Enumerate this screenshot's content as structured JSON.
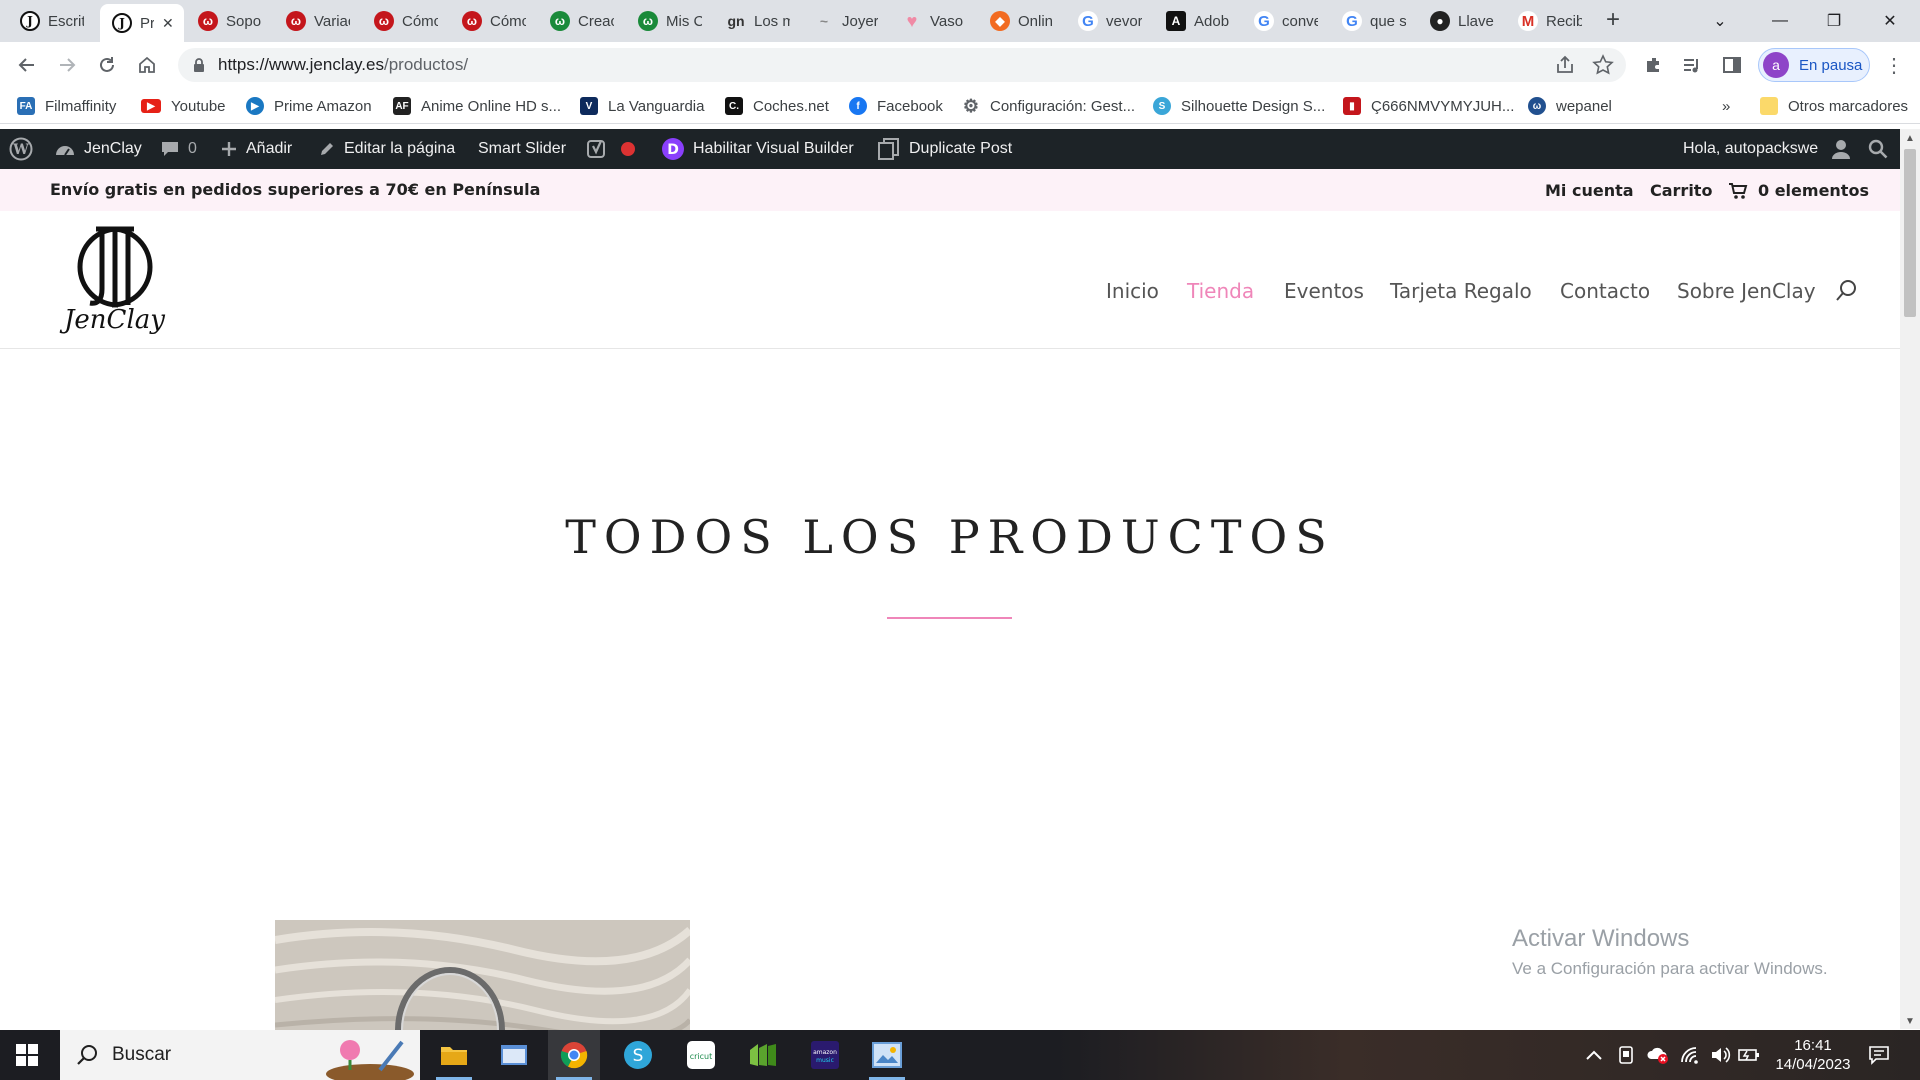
{
  "browser": {
    "tabs": [
      {
        "title": "Escrit",
        "icon": "jenclay-favicon"
      },
      {
        "title": "Pr",
        "icon": "jenclay-favicon",
        "active": true
      },
      {
        "title": "Sopo",
        "icon": "wpml-favicon"
      },
      {
        "title": "Variac",
        "icon": "wpml-favicon"
      },
      {
        "title": "Cómc",
        "icon": "wpml-favicon"
      },
      {
        "title": "Cómc",
        "icon": "wpml-favicon"
      },
      {
        "title": "Creac",
        "icon": "wp-green-favicon"
      },
      {
        "title": "Mis C",
        "icon": "wp-green-favicon"
      },
      {
        "title": "Los m",
        "icon": "gn-favicon"
      },
      {
        "title": "Joyer",
        "icon": "jewelry-favicon"
      },
      {
        "title": "Vaso",
        "icon": "heart-favicon"
      },
      {
        "title": "Onlin",
        "icon": "orange-favicon"
      },
      {
        "title": "vevor",
        "icon": "google-favicon"
      },
      {
        "title": "Adob",
        "icon": "adobe-favicon"
      },
      {
        "title": "conve",
        "icon": "google-favicon"
      },
      {
        "title": "que s",
        "icon": "google-favicon"
      },
      {
        "title": "Llave",
        "icon": "dark-favicon"
      },
      {
        "title": "Recib",
        "icon": "gmail-favicon"
      }
    ],
    "url_host": "https://www.jenclay.es",
    "url_path": "/productos/",
    "profile_initial": "a",
    "profile_label": "En pausa",
    "bookmarks": [
      {
        "label": "Filmaffinity",
        "color": "#2a6fb5"
      },
      {
        "label": "Youtube",
        "color": "#e62117"
      },
      {
        "label": "Prime Amazon",
        "color": "#1a78c2"
      },
      {
        "label": "Anime Online HD s...",
        "color": "#222222"
      },
      {
        "label": "La Vanguardia",
        "color": "#0d2a5c"
      },
      {
        "label": "Coches.net",
        "color": "#111111"
      },
      {
        "label": "Facebook",
        "color": "#1877f2"
      },
      {
        "label": "Configuración: Gest...",
        "color": "#5f6368"
      },
      {
        "label": "Silhouette Design S...",
        "color": "#3aa6d8"
      },
      {
        "label": "Ç666NMVYMYJUH...",
        "color": "#c4161c"
      },
      {
        "label": "wepanel",
        "color": "#21508f"
      }
    ],
    "bookmarks_more": "»",
    "other_bookmarks": "Otros marcadores"
  },
  "wp_admin_bar": {
    "site_name": "JenClay",
    "comments_count": "0",
    "add_new": "Añadir",
    "edit_page": "Editar la página",
    "smart_slider": "Smart Slider",
    "visual_builder": "Habilitar Visual Builder",
    "duplicate_post": "Duplicate Post",
    "greeting": "Hola, autopackswe"
  },
  "site": {
    "promo_text": "Envío gratis en pedidos superiores a 70€ en Península",
    "my_account": "Mi cuenta",
    "cart": "Carrito",
    "cart_items": "0 elementos",
    "logo_text": "JenClay",
    "nav": [
      {
        "label": "Inicio"
      },
      {
        "label": "Tienda",
        "active": true
      },
      {
        "label": "Eventos"
      },
      {
        "label": "Tarjeta Regalo"
      },
      {
        "label": "Contacto"
      },
      {
        "label": "Sobre JenClay"
      }
    ],
    "page_title": "TODOS LOS PRODUCTOS",
    "accent_color": "#ef86b9"
  },
  "windows": {
    "activate_title": "Activar Windows",
    "activate_sub": "Ve a Configuración para activar Windows.",
    "search_label": "Buscar",
    "time": "16:41",
    "date": "14/04/2023"
  }
}
